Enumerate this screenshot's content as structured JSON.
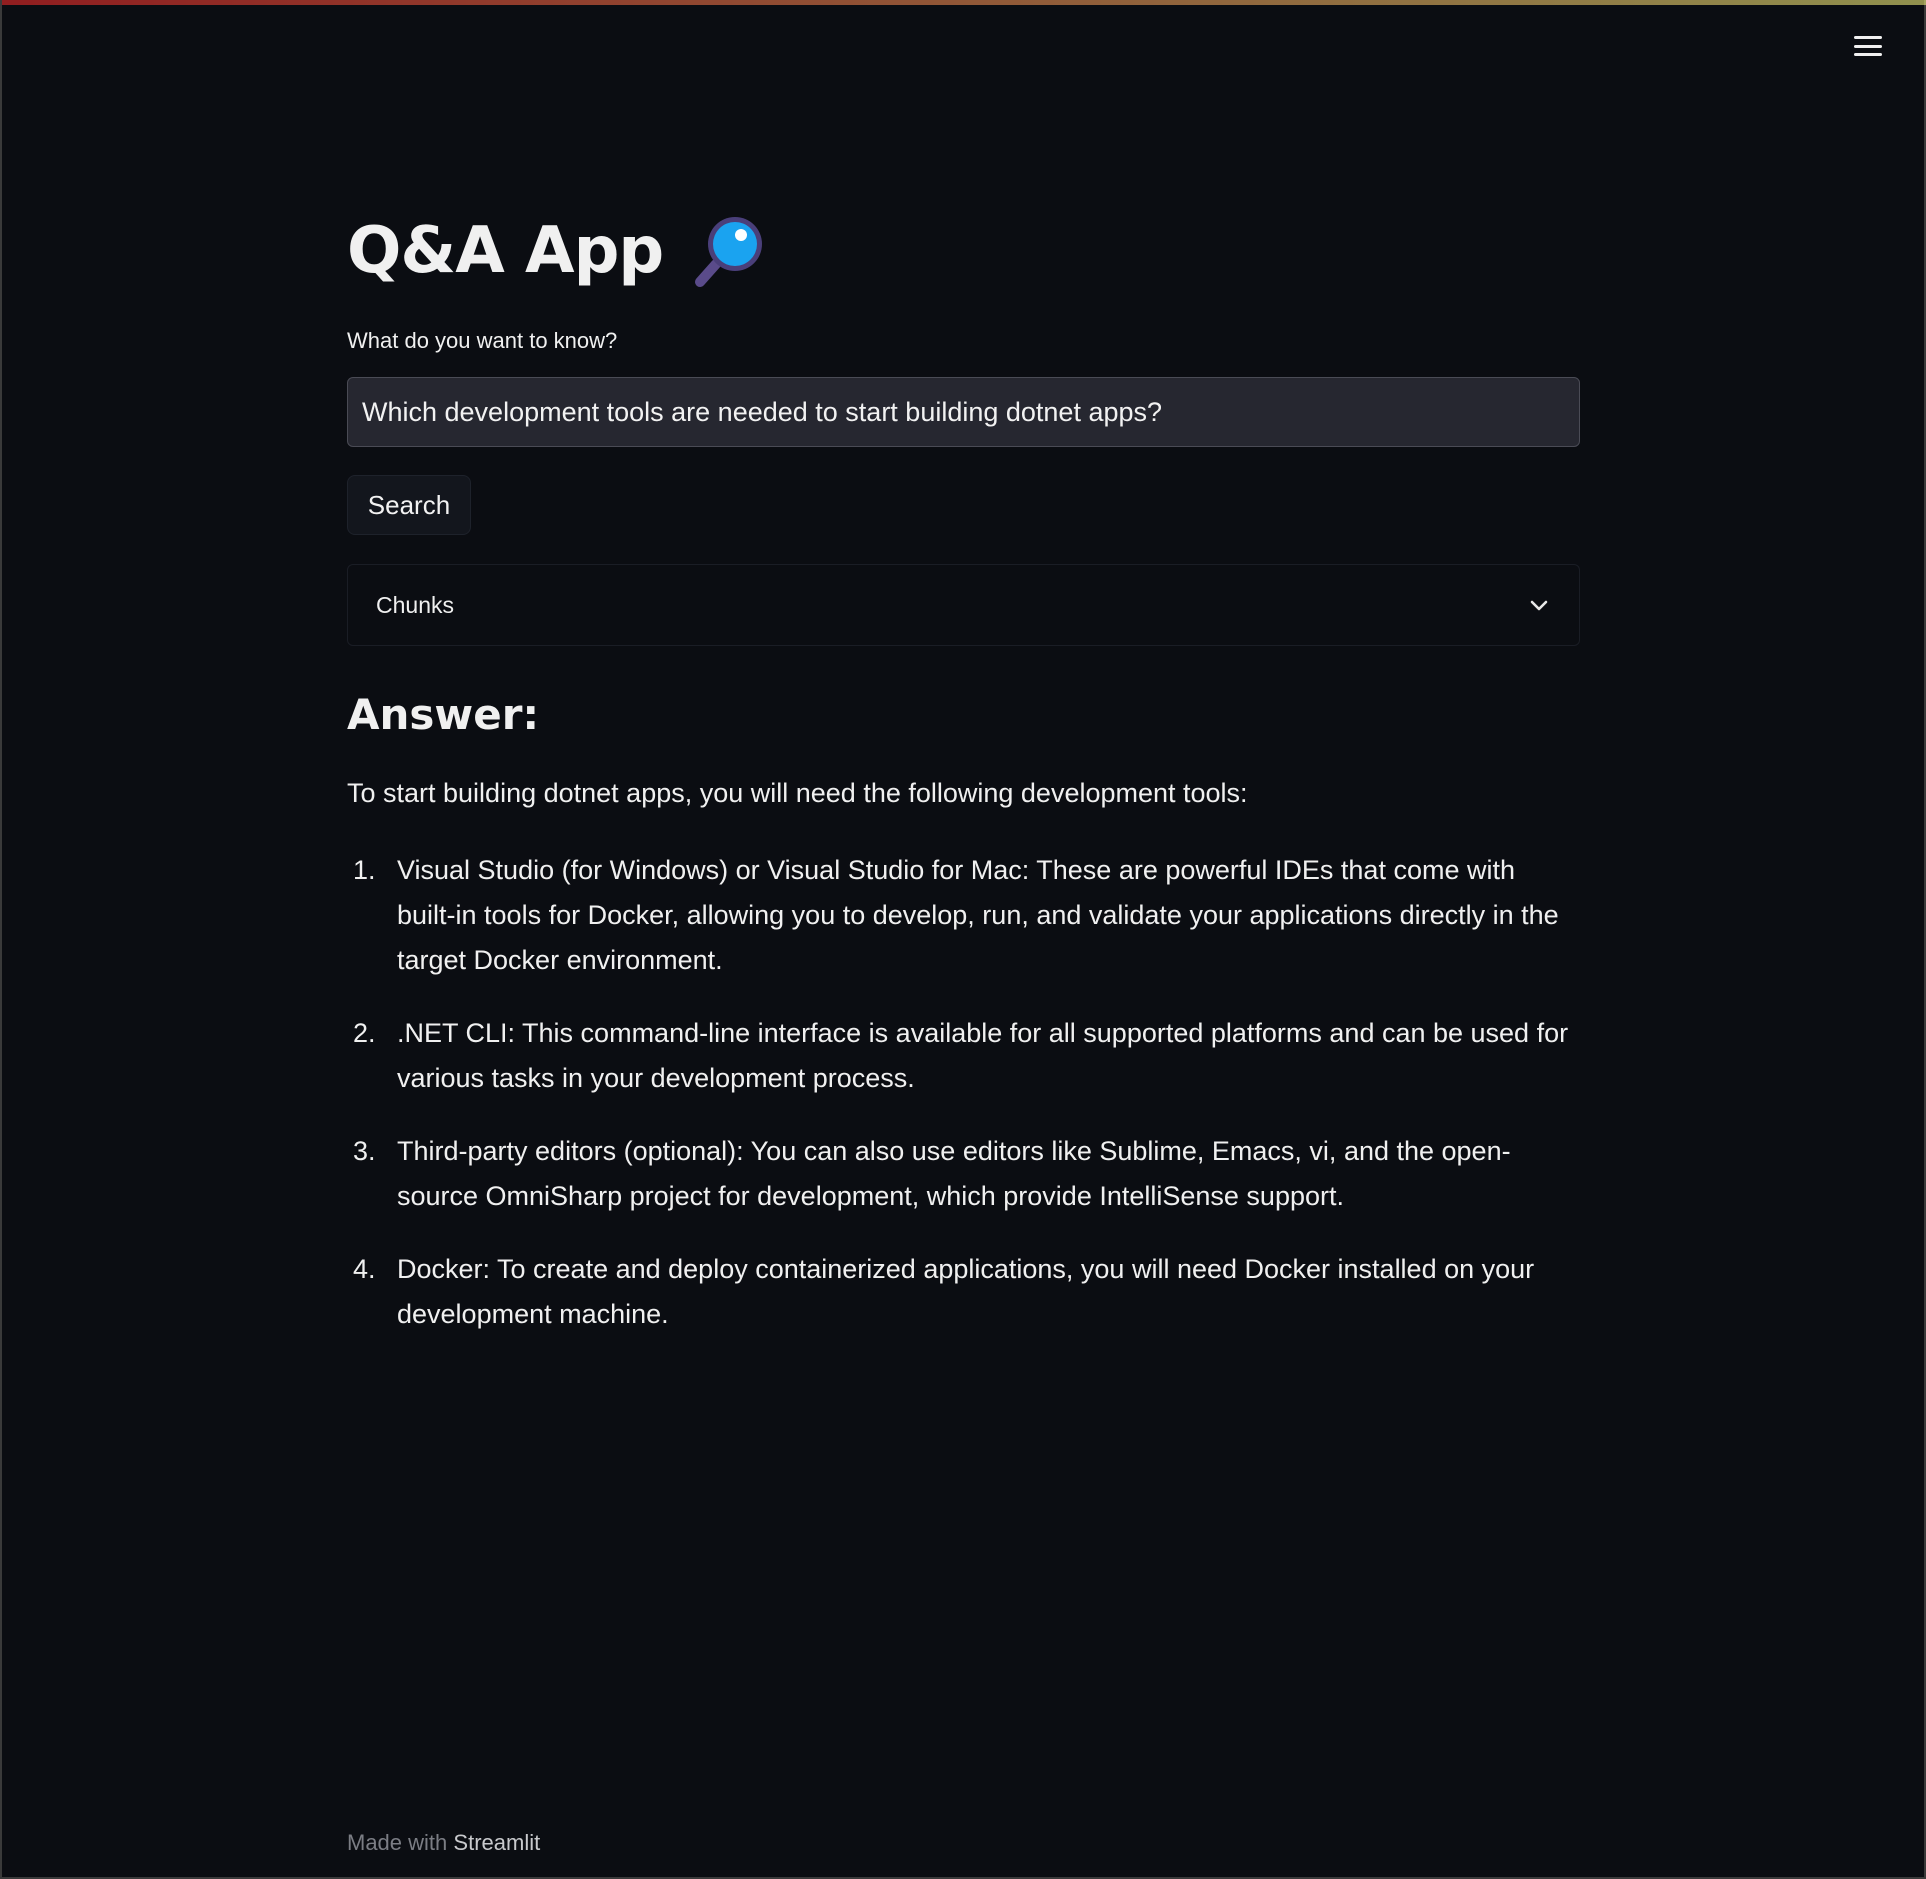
{
  "app": {
    "title": "Q&A App",
    "title_icon": "magnifier-icon"
  },
  "header": {
    "menu_icon": "hamburger-menu-icon"
  },
  "form": {
    "label": "What do you want to know?",
    "question_value": "Which development tools are needed to start building dotnet apps?",
    "search_label": "Search"
  },
  "expander": {
    "label": "Chunks",
    "state": "collapsed"
  },
  "answer": {
    "heading": "Answer:",
    "intro": "To start building dotnet apps, you will need the following development tools:",
    "items": [
      {
        "num": "1.",
        "text": "Visual Studio (for Windows) or Visual Studio for Mac: These are powerful IDEs that come with built-in tools for Docker, allowing you to develop, run, and validate your applications directly in the target Docker environment."
      },
      {
        "num": "2.",
        "text": ".NET CLI: This command-line interface is available for all supported platforms and can be used for various tasks in your development process."
      },
      {
        "num": "3.",
        "text": "Third-party editors (optional): You can also use editors like Sublime, Emacs, vi, and the open-source OmniSharp project for development, which provide IntelliSense support."
      },
      {
        "num": "4.",
        "text": "Docker: To create and deploy containerized applications, you will need Docker installed on your development machine."
      }
    ]
  },
  "footer": {
    "prefix": "Made with",
    "brand": "Streamlit"
  },
  "colors": {
    "background": "#0b0d12",
    "input_background": "#262730",
    "text": "#f0f0f0",
    "footer_text": "#7b7d84",
    "top_decoration_start": "#ff4b4b",
    "top_decoration_end": "#fffd80"
  }
}
